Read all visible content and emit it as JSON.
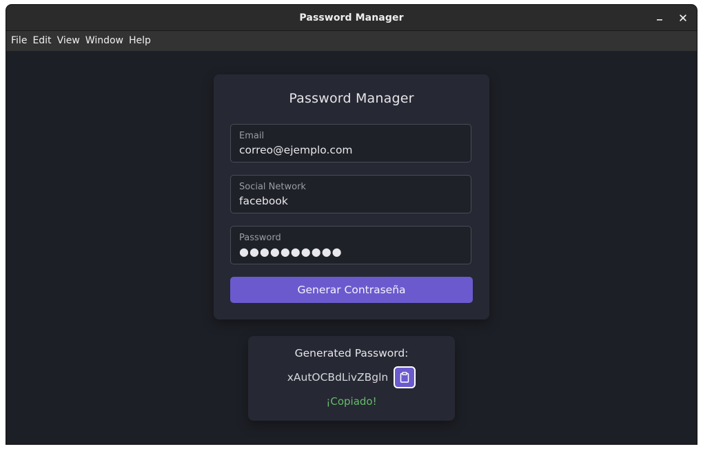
{
  "window": {
    "title": "Password Manager"
  },
  "menubar": {
    "items": [
      "File",
      "Edit",
      "View",
      "Window",
      "Help"
    ]
  },
  "form": {
    "title": "Password Manager",
    "email": {
      "label": "Email",
      "value": "correo@ejemplo.com"
    },
    "social": {
      "label": "Social Network",
      "value": "facebook"
    },
    "password": {
      "label": "Password",
      "value": "●●●●●●●●●●"
    },
    "generate_label": "Generar Contraseña"
  },
  "result": {
    "title": "Generated Password:",
    "password": "xAutOCBdLivZBgln",
    "copied_message": "¡Copiado!"
  },
  "icons": {
    "minimize": "minimize-icon",
    "close": "close-icon",
    "copy": "clipboard-icon"
  },
  "colors": {
    "accent": "#6a5acd",
    "success": "#66bb6a",
    "background": "#1d1f26",
    "card": "#262833"
  }
}
